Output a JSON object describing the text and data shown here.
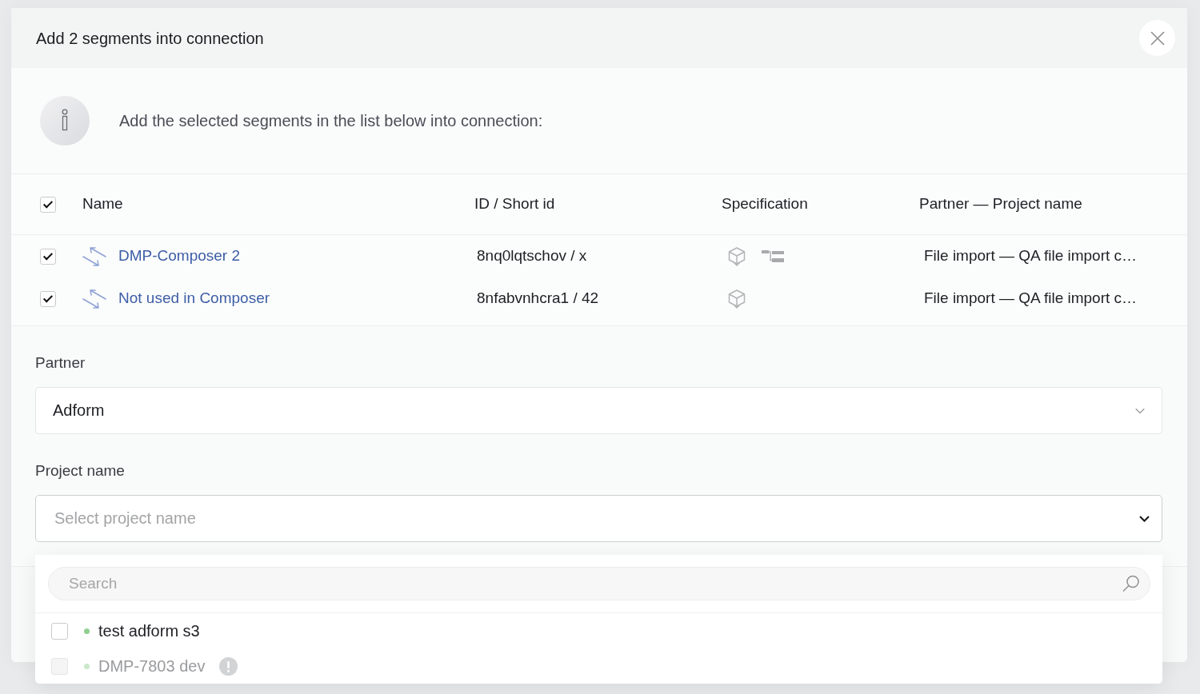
{
  "dialog": {
    "title": "Add 2 segments into connection",
    "info_text": "Add the selected segments in the list below into connection:",
    "table": {
      "all_checked": true,
      "columns": [
        "Name",
        "ID / Short id",
        "Specification",
        "Partner — Project name"
      ],
      "rows": [
        {
          "checked": true,
          "name": "DMP-Composer 2",
          "id": "8nq0lqtschov / x",
          "specification": [
            {
              "kind": "package"
            },
            {
              "kind": "hierarchy"
            }
          ],
          "partner_project": "File import — QA file import c…"
        },
        {
          "checked": true,
          "name": "Not used in Composer",
          "id": "8nfabvnhcra1 / 42",
          "specification": [
            {
              "kind": "package"
            }
          ],
          "partner_project": "File import — QA file import c…"
        }
      ]
    },
    "fields": [
      {
        "label": "Partner",
        "value": "Adform",
        "expanded": false
      },
      {
        "label": "Project name",
        "placeholder": "Select project name",
        "expanded": true,
        "dropdown": {
          "search_placeholder": "Search",
          "options": [
            {
              "label": "test adform s3",
              "checked": false,
              "disabled": false,
              "color": "#8fd08f",
              "warning": false
            },
            {
              "label": "DMP-7803 dev",
              "checked": false,
              "disabled": true,
              "color": "#cbe8cb",
              "warning": true
            }
          ]
        }
      }
    ]
  }
}
